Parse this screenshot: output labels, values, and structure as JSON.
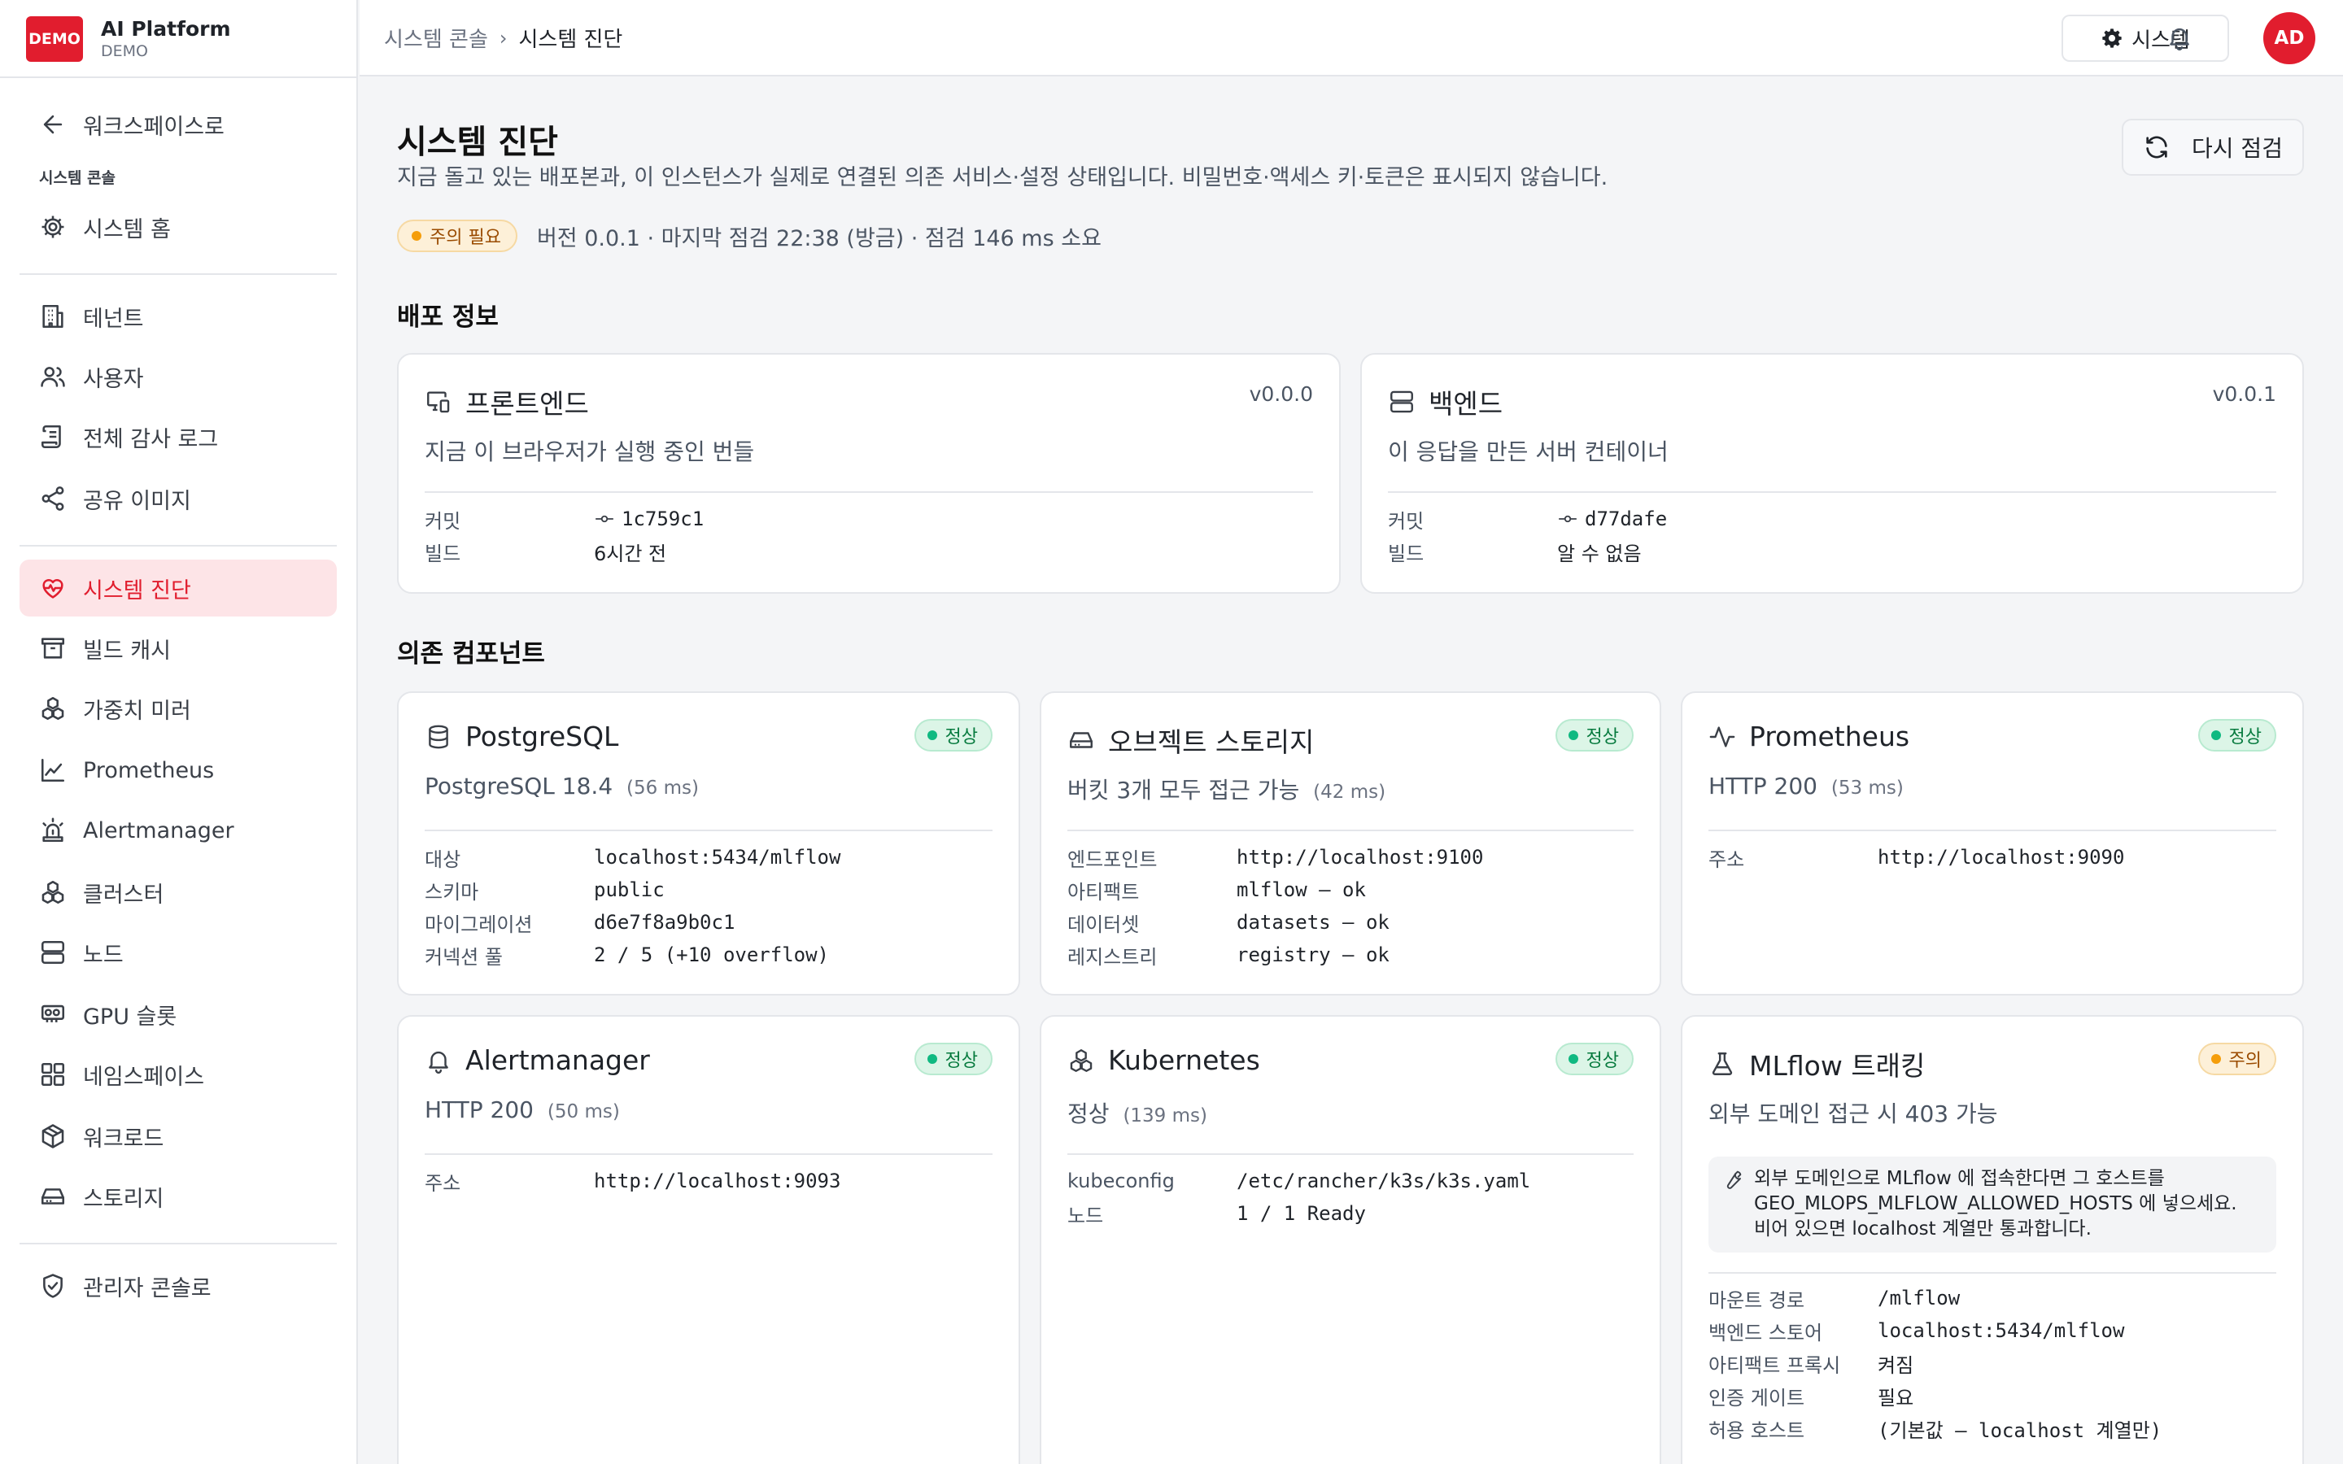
{
  "brand": {
    "badge": "DEMO",
    "name": "AI Platform",
    "sub": "DEMO"
  },
  "sidebar": {
    "back_label": "워크스페이스로",
    "section": "시스템 콘솔",
    "home": "시스템 홈",
    "items": [
      {
        "label": "테넌트",
        "icon": "building-icon"
      },
      {
        "label": "사용자",
        "icon": "users-icon"
      },
      {
        "label": "전체 감사 로그",
        "icon": "scroll-icon"
      },
      {
        "label": "공유 이미지",
        "icon": "share-icon"
      },
      {
        "label": "시스템 진단",
        "icon": "heart-pulse-icon",
        "active": true
      },
      {
        "label": "빌드 캐시",
        "icon": "archive-icon"
      },
      {
        "label": "가중치 미러",
        "icon": "boxes-icon"
      },
      {
        "label": "Prometheus",
        "icon": "line-chart-icon"
      },
      {
        "label": "Alertmanager",
        "icon": "siren-icon"
      },
      {
        "label": "클러스터",
        "icon": "boxes-icon"
      },
      {
        "label": "노드",
        "icon": "server-icon"
      },
      {
        "label": "GPU 슬롯",
        "icon": "gpu-icon"
      },
      {
        "label": "네임스페이스",
        "icon": "grid-icon"
      },
      {
        "label": "워크로드",
        "icon": "package-icon"
      },
      {
        "label": "스토리지",
        "icon": "hard-drive-icon"
      }
    ],
    "admin": "관리자 콘솔로"
  },
  "topbar": {
    "crumb_root": "시스템 콘솔",
    "crumb_current": "시스템 진단",
    "system_button": "시스템",
    "avatar": "AD"
  },
  "page": {
    "title": "시스템 진단",
    "description": "지금 돌고 있는 배포본과, 이 인스턴스가 실제로 연결된 의존 서비스·설정 상태입니다. 비밀번호·액세스 키·토큰은 표시되지 않습니다.",
    "recheck_button": "다시 점검",
    "status_badge": "주의 필요",
    "status_meta": "버전 0.0.1 · 마지막 점검 22:38 (방금) · 점검 146 ms 소요"
  },
  "deploy": {
    "section": "배포 정보",
    "frontend": {
      "title": "프론트엔드",
      "version": "v0.0.0",
      "subtitle": "지금 이 브라우저가 실행 중인 번들",
      "commit_label": "커밋",
      "commit": "1c759c1",
      "build_label": "빌드",
      "build": "6시간 전"
    },
    "backend": {
      "title": "백엔드",
      "version": "v0.0.1",
      "subtitle": "이 응답을 만든 서버 컨테이너",
      "commit_label": "커밋",
      "commit": "d77dafe",
      "build_label": "빌드",
      "build": "알 수 없음"
    }
  },
  "deps": {
    "section": "의존 컴포넌트",
    "postgres": {
      "title": "PostgreSQL",
      "status": "정상",
      "subtitle": "PostgreSQL 18.4",
      "latency": "(56 ms)",
      "rows": [
        [
          "대상",
          "localhost:5434/mlflow"
        ],
        [
          "스키마",
          "public"
        ],
        [
          "마이그레이션",
          "d6e7f8a9b0c1"
        ],
        [
          "커넥션 풀",
          "2 / 5 (+10 overflow)"
        ]
      ]
    },
    "storage": {
      "title": "오브젝트 스토리지",
      "status": "정상",
      "subtitle": "버킷 3개 모두 접근 가능",
      "latency": "(42 ms)",
      "rows": [
        [
          "엔드포인트",
          "http://localhost:9100"
        ],
        [
          "아티팩트",
          "mlflow — ok"
        ],
        [
          "데이터셋",
          "datasets — ok"
        ],
        [
          "레지스트리",
          "registry — ok"
        ]
      ]
    },
    "prometheus": {
      "title": "Prometheus",
      "status": "정상",
      "subtitle": "HTTP 200",
      "latency": "(53 ms)",
      "rows": [
        [
          "주소",
          "http://localhost:9090"
        ]
      ]
    },
    "alertmanager": {
      "title": "Alertmanager",
      "status": "정상",
      "subtitle": "HTTP 200",
      "latency": "(50 ms)",
      "rows": [
        [
          "주소",
          "http://localhost:9093"
        ]
      ]
    },
    "kubernetes": {
      "title": "Kubernetes",
      "status": "정상",
      "subtitle": "정상",
      "latency": "(139 ms)",
      "rows": [
        [
          "kubeconfig",
          "/etc/rancher/k3s/k3s.yaml"
        ],
        [
          "노드",
          "1 / 1 Ready"
        ]
      ]
    },
    "mlflow": {
      "title": "MLflow 트래킹",
      "status": "주의",
      "subtitle": "외부 도메인 접근 시 403 가능",
      "note": "외부 도메인으로 MLflow 에 접속한다면 그 호스트를 GEO_MLOPS_MLFLOW_ALLOWED_HOSTS 에 넣으세요. 비어 있으면 localhost 계열만 통과합니다.",
      "rows": [
        [
          "마운트 경로",
          "/mlflow"
        ],
        [
          "백엔드 스토어",
          "localhost:5434/mlflow"
        ],
        [
          "아티팩트 프록시",
          "켜짐"
        ],
        [
          "인증 게이트",
          "필요"
        ],
        [
          "허용 호스트",
          "(기본값 — localhost 계열만)"
        ]
      ]
    }
  }
}
